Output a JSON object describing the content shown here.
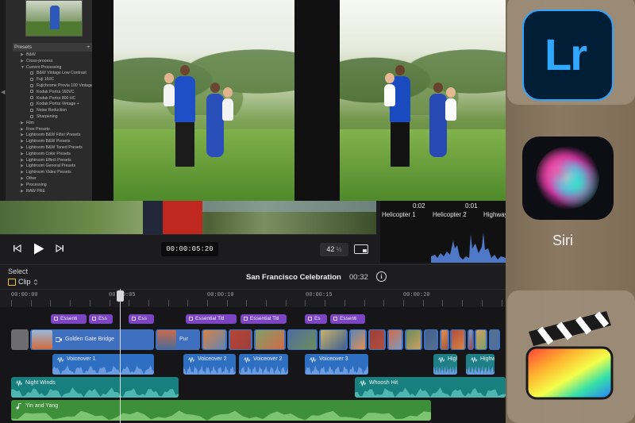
{
  "lightroom": {
    "panel_title": "Presets",
    "panel_add": "+",
    "side_tab": "◀",
    "presets": [
      {
        "label": "B&W",
        "depth": 1,
        "expanded": false
      },
      {
        "label": "Cross-process",
        "depth": 1,
        "expanded": false
      },
      {
        "label": "Current Processing",
        "depth": 1,
        "expanded": true
      },
      {
        "label": "B&W Vintage Low Contrast",
        "depth": 2
      },
      {
        "label": "Fuji 160C",
        "depth": 2
      },
      {
        "label": "Fujichrome Provia 100 Vintage",
        "depth": 2
      },
      {
        "label": "Kodak Portra 160VC",
        "depth": 2
      },
      {
        "label": "Kodak Portra 800 HC",
        "depth": 2
      },
      {
        "label": "Kodak Portra Vintage +",
        "depth": 2
      },
      {
        "label": "Noise Reduction",
        "depth": 2
      },
      {
        "label": "Sharpening",
        "depth": 2
      },
      {
        "label": "Film",
        "depth": 1,
        "expanded": false
      },
      {
        "label": "Free Presets",
        "depth": 1,
        "expanded": false
      },
      {
        "label": "Lightroom B&W Filter Presets",
        "depth": 1,
        "expanded": false
      },
      {
        "label": "Lightroom B&W Presets",
        "depth": 1,
        "expanded": false
      },
      {
        "label": "Lightroom B&W Toned Presets",
        "depth": 1,
        "expanded": false
      },
      {
        "label": "Lightroom Color Presets",
        "depth": 1,
        "expanded": false
      },
      {
        "label": "Lightroom Effect Presets",
        "depth": 1,
        "expanded": false
      },
      {
        "label": "Lightroom General Presets",
        "depth": 1,
        "expanded": false
      },
      {
        "label": "Lightroom Video Presets",
        "depth": 1,
        "expanded": false
      },
      {
        "label": "Other",
        "depth": 1,
        "expanded": false
      },
      {
        "label": "Processing",
        "depth": 1,
        "expanded": false
      },
      {
        "label": "RAW PRE",
        "depth": 1,
        "expanded": false
      }
    ]
  },
  "final_cut": {
    "audio_pane": {
      "timecodes": [
        "0:02",
        "0:01"
      ],
      "names": [
        "Helicopter 1",
        "Helicopter 2",
        "Highway"
      ]
    },
    "transport": {
      "timecode": "00:00:05:20",
      "zoom_value": "42",
      "zoom_unit": "%"
    },
    "header": {
      "select_label": "Select",
      "clip_label": "Clip",
      "project_title": "San Francisco Celebration",
      "project_duration": "00:32",
      "info_glyph": "i"
    },
    "ruler": [
      "00:00:00",
      "00:00:05",
      "00:00:10",
      "00:00:15",
      "00:00:20"
    ],
    "titles": [
      "Essenti",
      "Ess",
      "Ess",
      "Essential Titl",
      "Essential Titl",
      "Es",
      "Essenti"
    ],
    "primary_clip": "Golden Gate Bridge",
    "secondary_clip": "Pur",
    "voiceovers": [
      "Voiceover 1",
      "Voiceover 2",
      "Voiceover 2",
      "Voiceover 3",
      "High",
      "Highw"
    ],
    "music": [
      "Night Winds",
      "Whoosh Hit",
      "Yin and Yang"
    ]
  },
  "app_switcher": {
    "lightroom_icon_text": "Lr",
    "siri_label": "Siri"
  },
  "colors": {
    "title_clip": "#7b45c4",
    "video_clip": "#3f6fbf",
    "voiceover_clip": "#2f6fc2",
    "music_teal": "#17807f",
    "music_green": "#3e8f3a",
    "lr_blue": "#31a8ff",
    "clip_yellow": "#f0c419"
  }
}
